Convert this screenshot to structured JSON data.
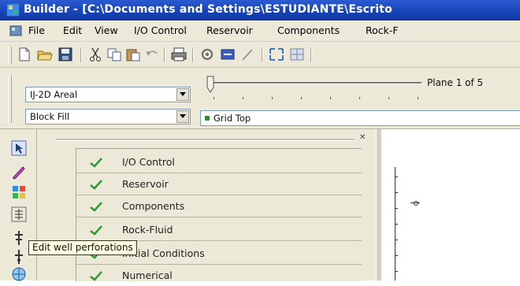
{
  "window": {
    "title": "Builder - [C:\\Documents and Settings\\ESTUDIANTE\\Escrito",
    "app_icon": "builder-app-icon"
  },
  "menu": {
    "items": [
      {
        "label": "File"
      },
      {
        "label": "Edit"
      },
      {
        "label": "View"
      },
      {
        "label": "I/O Control"
      },
      {
        "label": "Reservoir"
      },
      {
        "label": "Components"
      },
      {
        "label": "Rock-F"
      }
    ]
  },
  "toolbar": {
    "icons": [
      "new-file-icon",
      "open-folder-icon",
      "save-icon",
      "cut-icon",
      "copy-icon",
      "paste-icon",
      "undo-icon",
      "print-icon",
      "settings-icon",
      "validate-icon",
      "draw-icon",
      "zoom-icon",
      "grid-icon"
    ]
  },
  "view_controls": {
    "view_mode": "IJ-2D Areal",
    "fill_mode": "Block Fill",
    "layer": "Grid Top",
    "plane_label": "Plane 1 of 5"
  },
  "tree": {
    "items": [
      {
        "label": "I/O Control"
      },
      {
        "label": "Reservoir"
      },
      {
        "label": "Components"
      },
      {
        "label": "Rock-Fluid"
      },
      {
        "label": "Initial Conditions"
      },
      {
        "label": "Numerical"
      }
    ]
  },
  "tooltip": {
    "text": "Edit well perforations"
  },
  "colors": {
    "titlebar": "#1845b8",
    "chrome": "#ece9d8",
    "check": "#2f9a2f",
    "tooltip_bg": "#ffffe1"
  }
}
